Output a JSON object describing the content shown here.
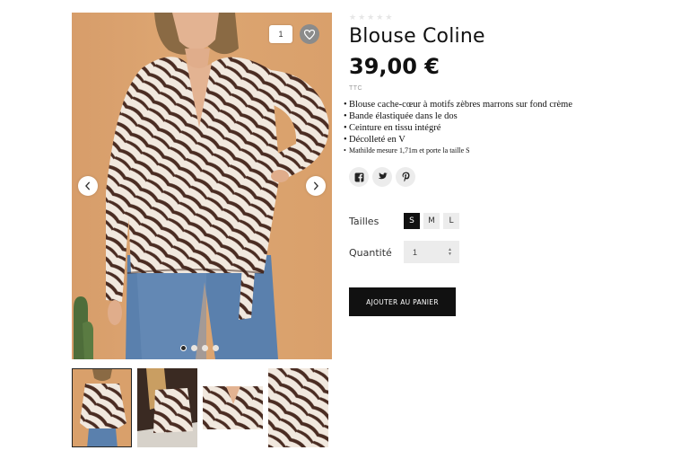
{
  "gallery": {
    "wishlist_count": "1",
    "slides": 4,
    "active_slide": 0,
    "icons": {
      "wishlist": "heart-icon",
      "prev": "chevron-left-icon",
      "next": "chevron-right-icon"
    }
  },
  "product": {
    "rating_stars_filled": 0,
    "rating_stars_total": 5,
    "title": "Blouse Coline",
    "price": "39,00 €",
    "tax_label": "TTC",
    "features": [
      "Blouse cache-cœur à motifs zèbres marrons sur fond crème",
      "Bande élastiquée dans le dos",
      "Ceinture en tissu intégré",
      "Décolleté en V",
      "Mathilde mesure 1,71m et porte la taille S"
    ],
    "share_icons": [
      "facebook-icon",
      "twitter-icon",
      "pinterest-icon"
    ]
  },
  "options": {
    "sizes_label": "Tailles",
    "sizes": [
      "S",
      "M",
      "L"
    ],
    "selected_size": "S",
    "quantity_label": "Quantité",
    "quantity_value": "1"
  },
  "cart": {
    "add_label": "AJOUTER AU PANIER"
  },
  "colors": {
    "accent": "#111111",
    "background_photo": "#d9a06b",
    "chip": "#ececec"
  }
}
